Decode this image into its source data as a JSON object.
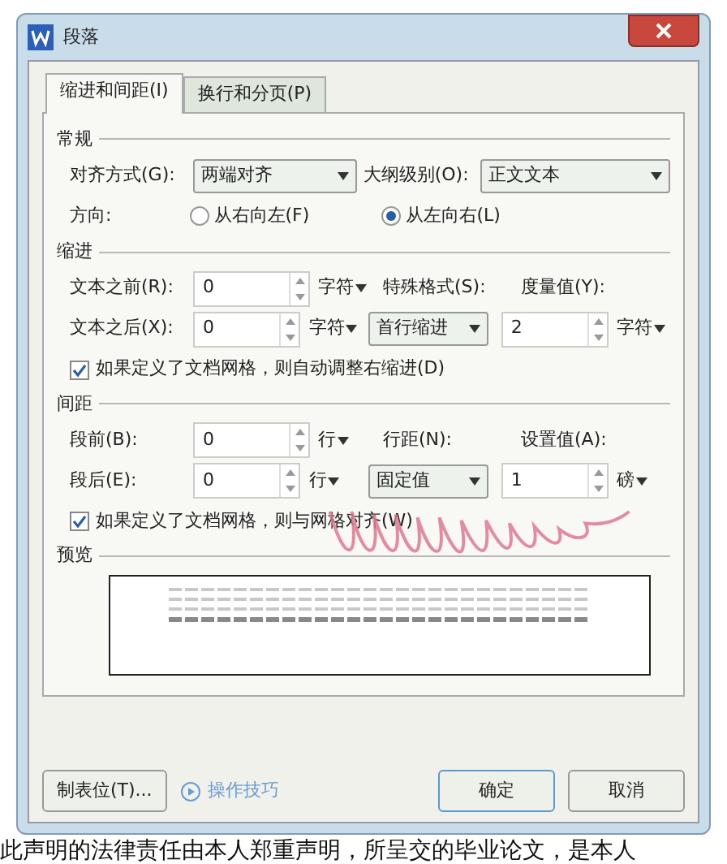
{
  "window": {
    "title": "段落"
  },
  "tabs": [
    {
      "label": "缩进和间距(I)",
      "selected": true
    },
    {
      "label": "换行和分页(P)",
      "selected": false
    }
  ],
  "general": {
    "title": "常规",
    "alignment_label": "对齐方式(G):",
    "alignment": "两端对齐",
    "outline_label": "大纲级别(O):",
    "outline": "正文文本",
    "direction_label": "方向:",
    "directions": [
      {
        "label": "从右向左(F)",
        "selected": false
      },
      {
        "label": "从左向右(L)",
        "selected": true
      }
    ]
  },
  "indent": {
    "title": "缩进",
    "before_label": "文本之前(R):",
    "before": "0",
    "before_unit": "字符",
    "after_label": "文本之后(X):",
    "after": "0",
    "after_unit": "字符",
    "special_label": "特殊格式(S):",
    "special": "首行缩进",
    "measure_label": "度量值(Y):",
    "measure": "2",
    "measure_unit": "字符",
    "checkbox": {
      "label": "如果定义了文档网格，则自动调整右缩进(D)",
      "checked": true
    }
  },
  "spacing": {
    "title": "间距",
    "before_label": "段前(B):",
    "before": "0",
    "before_unit": "行",
    "after_label": "段后(E):",
    "after": "0",
    "after_unit": "行",
    "line_label": "行距(N):",
    "line": "固定值",
    "value_label": "设置值(A):",
    "value": "1",
    "value_unit": "磅",
    "checkbox": {
      "label": "如果定义了文档网格，则与网格对齐(W)",
      "checked": true
    }
  },
  "preview": {
    "title": "预览"
  },
  "footer": {
    "tabs_button": "制表位(T)...",
    "tips_link": "操作技巧",
    "ok": "确定",
    "cancel": "取消"
  },
  "document": {
    "bottom_line": "此声明的法律责任由本人郑重声明，所呈交的毕业论文，是本人"
  }
}
